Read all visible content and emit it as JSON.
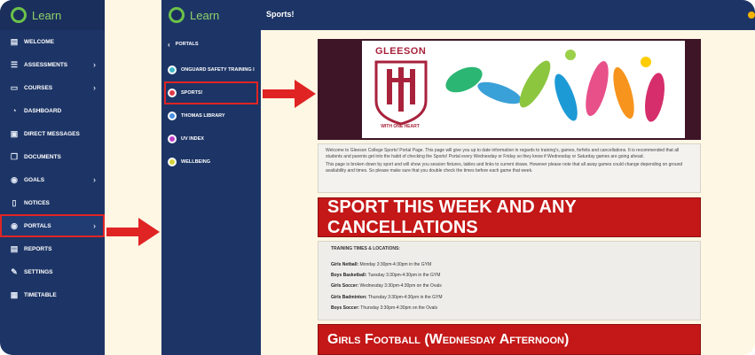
{
  "app": {
    "brand": "Learn",
    "page_title": "Sports!"
  },
  "nav_primary": [
    {
      "label": "WELCOME",
      "icon": "doc-icon",
      "chevron": false
    },
    {
      "label": "ASSESSMENTS",
      "icon": "checklist-icon",
      "chevron": true
    },
    {
      "label": "COURSES",
      "icon": "monitor-icon",
      "chevron": true
    },
    {
      "label": "DASHBOARD",
      "icon": "gauge-icon",
      "chevron": false
    },
    {
      "label": "DIRECT MESSAGES",
      "icon": "message-icon",
      "chevron": false
    },
    {
      "label": "DOCUMENTS",
      "icon": "documents-icon",
      "chevron": false
    },
    {
      "label": "GOALS",
      "icon": "target-icon",
      "chevron": true
    },
    {
      "label": "NOTICES",
      "icon": "notice-icon",
      "chevron": false
    },
    {
      "label": "PORTALS",
      "icon": "portal-icon",
      "chevron": true,
      "highlighted": true
    },
    {
      "label": "REPORTS",
      "icon": "report-icon",
      "chevron": false
    },
    {
      "label": "SETTINGS",
      "icon": "wrench-icon",
      "chevron": false
    },
    {
      "label": "TIMETABLE",
      "icon": "calendar-icon",
      "chevron": false
    }
  ],
  "nav_secondary": {
    "back_label": "PORTALS",
    "items": [
      {
        "label": "ONGUARD SAFETY TRAINING I",
        "color": "#3fb7c9"
      },
      {
        "label": "SPORTS!",
        "color": "#e0394a",
        "highlighted": true
      },
      {
        "label": "THOMAS LIBRARY",
        "color": "#4a90e2"
      },
      {
        "label": "UV INDEX",
        "color": "#c040c8"
      },
      {
        "label": "WELLBEING",
        "color": "#d5d23a"
      }
    ]
  },
  "banner": {
    "school": "GLEESON",
    "motto": "WITH ONE HEART"
  },
  "intro": {
    "p1": "Welcome to Gleeson College Sports! Portal Page. This page will give you up to date information in regards to training's, games, forfeits and cancellations. It is recommended that all students and parents get into the habit of checking the Sports! Portal every Wednesday or Friday so they know if Wednesday or Saturday games are going ahead.",
    "p2": "This page is broken down by sport and will show you session fixtures, tables and links to current draws. However please note that all away games could change depending on ground availability and times. So please make sure that you double check the times before each game that week."
  },
  "section1_heading": "SPORT THIS WEEK AND ANY CANCELLATIONS",
  "training": {
    "heading": "TRAINING TIMES & LOCATIONS:",
    "rows": [
      {
        "sport": "Girls Netball:",
        "detail": "Monday 3:30pm-4:30pm in the GYM"
      },
      {
        "sport": "Boys Basketball:",
        "detail": "Tuesday 3:30pm-4:30pm in the GYM"
      },
      {
        "sport": "Girls Soccer:",
        "detail": "Wednesday 3:30pm-4:30pm on the Ovals"
      },
      {
        "sport": "Girls Badminton:",
        "detail": "Thursday 3:30pm-4:30pm in the GYM"
      },
      {
        "sport": "Boys Soccer:",
        "detail": "Thursday 3:30pm-4:30pm on the Ovals"
      }
    ]
  },
  "section2_heading": "Girls Football (Wednesday Afternoon)",
  "colors": {
    "nav": "#1d3566",
    "accent": "#6cc24a",
    "highlight": "#e02424",
    "heading_red": "#c41717",
    "banner_dark": "#3d1527"
  }
}
